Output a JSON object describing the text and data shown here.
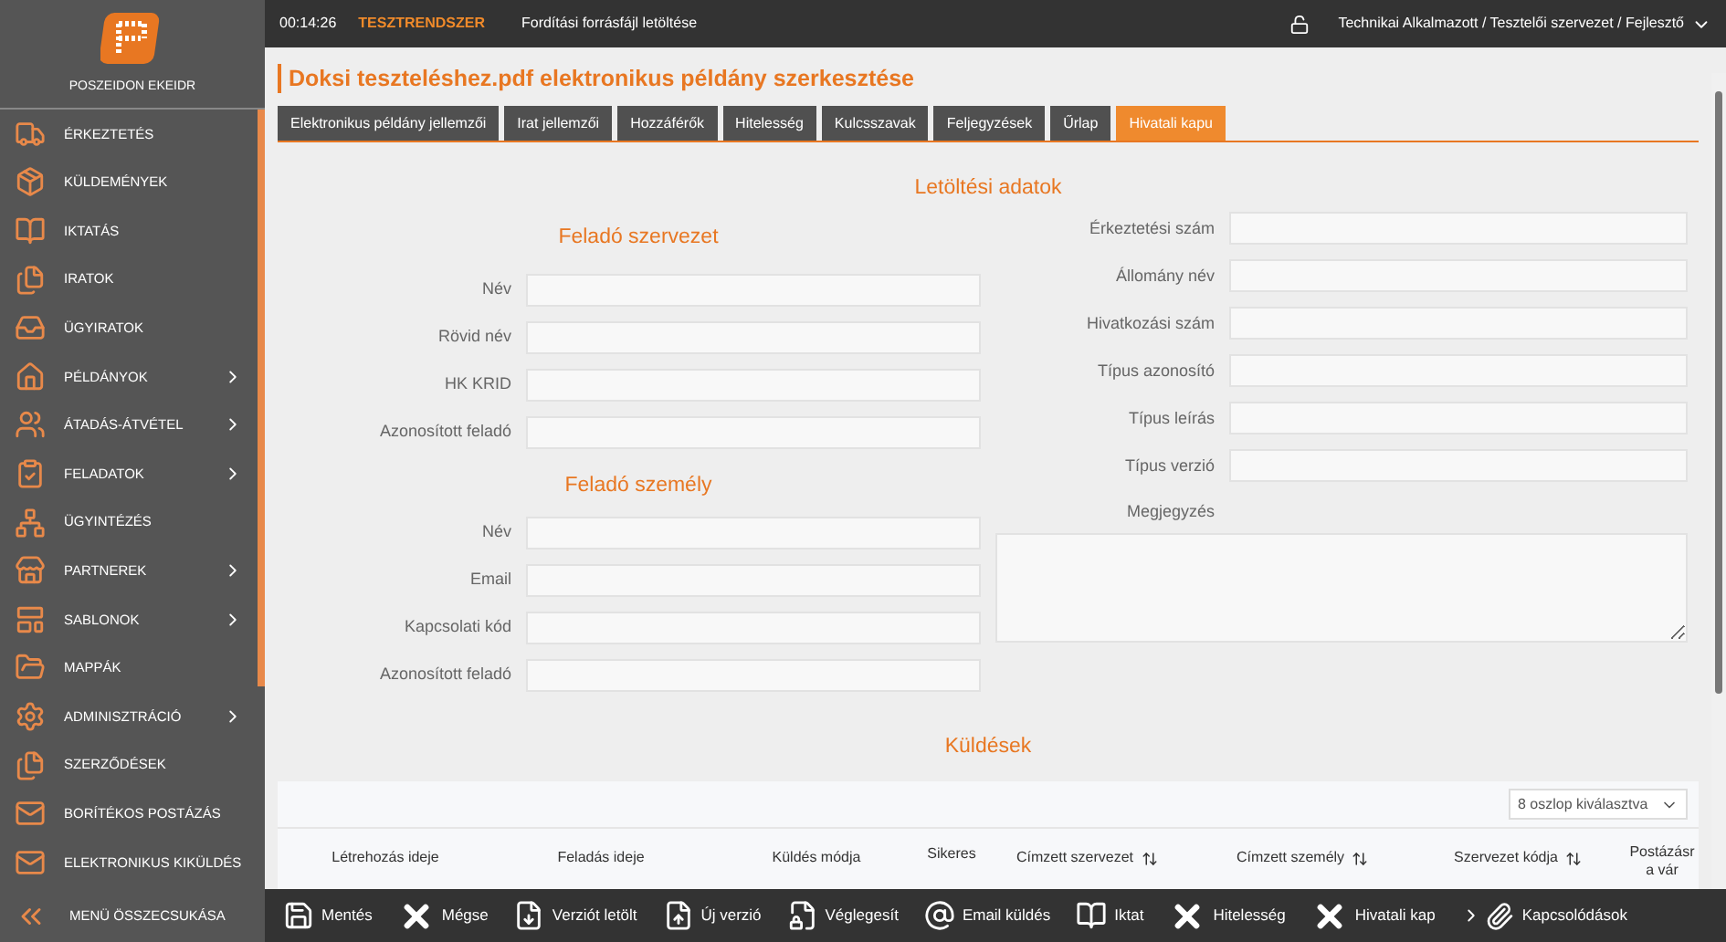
{
  "sidebar": {
    "app_name": "POSZEIDON EKEIDR",
    "items": [
      {
        "kind": "cart",
        "label": "ÉRKEZTETÉS",
        "has_submenu": false
      },
      {
        "kind": "box",
        "label": "KÜLDEMÉNYEK",
        "has_submenu": false
      },
      {
        "kind": "book",
        "label": "IKTATÁS",
        "has_submenu": false
      },
      {
        "kind": "files",
        "label": "IRATOK",
        "has_submenu": false
      },
      {
        "kind": "inbox",
        "label": "ÜGYIRATOK",
        "has_submenu": false
      },
      {
        "kind": "house",
        "label": "PÉLDÁNYOK",
        "has_submenu": true
      },
      {
        "kind": "people",
        "label": "ÁTADÁS-ÁTVÉTEL",
        "has_submenu": true
      },
      {
        "kind": "clipboard",
        "label": "FELADATOK",
        "has_submenu": true
      },
      {
        "kind": "network",
        "label": "ÜGYINTÉZÉS",
        "has_submenu": false
      },
      {
        "kind": "store",
        "label": "PARTNEREK",
        "has_submenu": true
      },
      {
        "kind": "template",
        "label": "SABLONOK",
        "has_submenu": true
      },
      {
        "kind": "folder",
        "label": "MAPPÁK",
        "has_submenu": false
      },
      {
        "kind": "gear",
        "label": "ADMINISZTRÁCIÓ",
        "has_submenu": true
      },
      {
        "kind": "files",
        "label": "SZERZŐDÉSEK",
        "has_submenu": false
      },
      {
        "kind": "mail",
        "label": "BORÍTÉKOS POSTÁZÁS",
        "has_submenu": false
      },
      {
        "kind": "mail",
        "label": "ELEKTRONIKUS KIKÜLDÉS"
      }
    ],
    "collapse_label": "MENÜ ÖSSZECSUKÁSA"
  },
  "topbar": {
    "time": "00:14:26",
    "environment": "TESZTRENDSZER",
    "message": "Fordítási forrásfájl letöltése",
    "user": "Technikai Alkalmazott / Tesztelői szervezet / Fejlesztő"
  },
  "page_title": "Doksi teszteléshez.pdf elektronikus példány szerkesztése",
  "tabs": [
    {
      "label": "Elektronikus példány jellemzői",
      "selected": false
    },
    {
      "label": "Irat jellemzői",
      "selected": false
    },
    {
      "label": "Hozzáférők",
      "selected": false
    },
    {
      "label": "Hitelesség",
      "selected": false
    },
    {
      "label": "Kulcsszavak",
      "selected": false
    },
    {
      "label": "Feljegyzések",
      "selected": false
    },
    {
      "label": "Űrlap",
      "selected": false
    },
    {
      "label": "Hivatali kapu",
      "selected": true
    }
  ],
  "download_section": {
    "title": "Letöltési adatok",
    "fields": [
      {
        "label": "Érkeztetési szám"
      },
      {
        "label": "Állomány név"
      },
      {
        "label": "Hivatkozási szám"
      },
      {
        "label": "Típus azonosító"
      },
      {
        "label": "Típus leírás"
      },
      {
        "label": "Típus verzió"
      }
    ],
    "note_label": "Megjegyzés"
  },
  "sender_organization": {
    "title": "Feladó szervezet",
    "fields": [
      {
        "label": "Név"
      },
      {
        "label": "Rövid név"
      },
      {
        "label": "HK KRID"
      },
      {
        "label": "Azonosított feladó"
      }
    ]
  },
  "sender_person": {
    "title": "Feladó személy",
    "fields": [
      {
        "label": "Név"
      },
      {
        "label": "Email"
      },
      {
        "label": "Kapcsolati kód"
      },
      {
        "label": "Azonosított feladó"
      }
    ]
  },
  "sends": {
    "title": "Küldések",
    "column_picker": "8 oszlop kiválasztva",
    "columns": [
      {
        "label": "Létrehozás ideje",
        "sortable": false
      },
      {
        "label": "Feladás ideje",
        "sortable": false
      },
      {
        "label": "Küldés módja",
        "sortable": false
      },
      {
        "label": "Sikeres",
        "sortable": false
      },
      {
        "label": "Címzett szervezet",
        "sortable": true
      },
      {
        "label": "Címzett személy",
        "sortable": true
      },
      {
        "label": "Szervezet kódja",
        "sortable": true
      },
      {
        "label": "Postázásra vár",
        "sortable": false
      }
    ]
  },
  "toolbar": {
    "buttons": [
      {
        "kind": "save",
        "label": "Mentés"
      },
      {
        "kind": "cross",
        "label": "Mégse"
      },
      {
        "kind": "download",
        "label": "Verziót letölt"
      },
      {
        "kind": "upload",
        "label": "Új verzió"
      },
      {
        "kind": "lock",
        "label": "Véglegesít"
      },
      {
        "kind": "at",
        "label": "Email küldés"
      },
      {
        "kind": "book",
        "label": "Iktat"
      },
      {
        "kind": "cross",
        "label": "Hitelesség"
      },
      {
        "kind": "cross",
        "label": "Hivatali kap"
      }
    ],
    "attachments": "Kapcsolódások"
  }
}
